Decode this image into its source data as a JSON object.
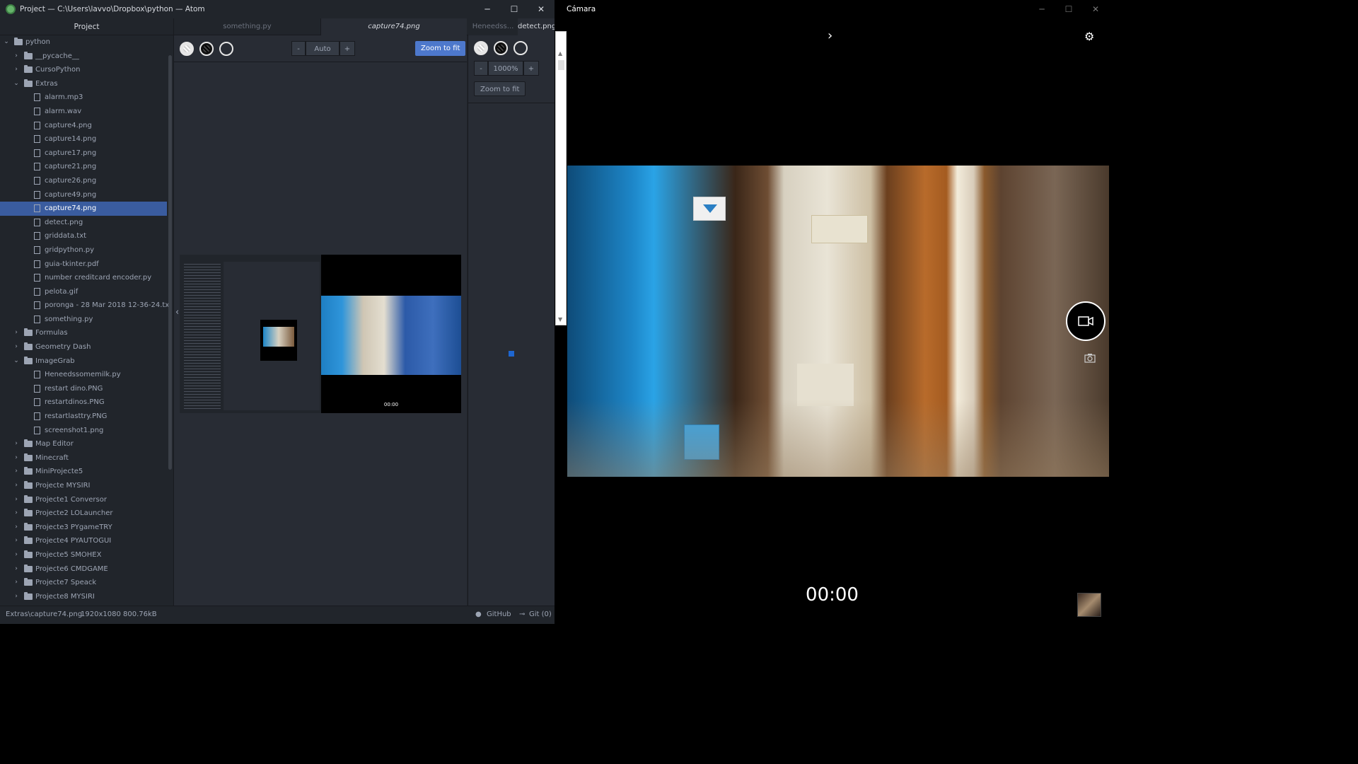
{
  "atom": {
    "title": "Project — C:\\Users\\lavvo\\Dropbox\\python — Atom",
    "minimize": "─",
    "maximize": "☐",
    "close": "✕",
    "tree_header": "Project",
    "tree": [
      {
        "label": "python",
        "type": "folder",
        "depth": 0,
        "open": true
      },
      {
        "label": "__pycache__",
        "type": "folder",
        "depth": 1,
        "open": false
      },
      {
        "label": "CursoPython",
        "type": "folder",
        "depth": 1,
        "open": false
      },
      {
        "label": "Extras",
        "type": "folder",
        "depth": 1,
        "open": true
      },
      {
        "label": "alarm.mp3",
        "type": "file",
        "depth": 2
      },
      {
        "label": "alarm.wav",
        "type": "file",
        "depth": 2
      },
      {
        "label": "capture4.png",
        "type": "file",
        "depth": 2
      },
      {
        "label": "capture14.png",
        "type": "file",
        "depth": 2
      },
      {
        "label": "capture17.png",
        "type": "file",
        "depth": 2
      },
      {
        "label": "capture21.png",
        "type": "file",
        "depth": 2
      },
      {
        "label": "capture26.png",
        "type": "file",
        "depth": 2
      },
      {
        "label": "capture49.png",
        "type": "file",
        "depth": 2
      },
      {
        "label": "capture74.png",
        "type": "file",
        "depth": 2,
        "selected": true
      },
      {
        "label": "detect.png",
        "type": "file",
        "depth": 2
      },
      {
        "label": "griddata.txt",
        "type": "file",
        "depth": 2
      },
      {
        "label": "gridpython.py",
        "type": "file",
        "depth": 2
      },
      {
        "label": "guia-tkinter.pdf",
        "type": "file",
        "depth": 2
      },
      {
        "label": "number creditcard encoder.py",
        "type": "file",
        "depth": 2
      },
      {
        "label": "pelota.gif",
        "type": "file",
        "depth": 2
      },
      {
        "label": "poronga - 28 Mar 2018 12-36-24.txt",
        "type": "file",
        "depth": 2
      },
      {
        "label": "something.py",
        "type": "file",
        "depth": 2
      },
      {
        "label": "Formulas",
        "type": "folder",
        "depth": 1,
        "open": false
      },
      {
        "label": "Geometry Dash",
        "type": "folder",
        "depth": 1,
        "open": false
      },
      {
        "label": "ImageGrab",
        "type": "folder",
        "depth": 1,
        "open": true
      },
      {
        "label": "Heneedssomemilk.py",
        "type": "file",
        "depth": 2
      },
      {
        "label": "restart dino.PNG",
        "type": "file",
        "depth": 2
      },
      {
        "label": "restartdinos.PNG",
        "type": "file",
        "depth": 2
      },
      {
        "label": "restartlasttry.PNG",
        "type": "file",
        "depth": 2
      },
      {
        "label": "screenshot1.png",
        "type": "file",
        "depth": 2
      },
      {
        "label": "Map Editor",
        "type": "folder",
        "depth": 1,
        "open": false
      },
      {
        "label": "Minecraft",
        "type": "folder",
        "depth": 1,
        "open": false
      },
      {
        "label": "MiniProjecte5",
        "type": "folder",
        "depth": 1,
        "open": false
      },
      {
        "label": "Projecte MYSIRI",
        "type": "folder",
        "depth": 1,
        "open": false
      },
      {
        "label": "Projecte1 Conversor",
        "type": "folder",
        "depth": 1,
        "open": false
      },
      {
        "label": "Projecte2 LOLauncher",
        "type": "folder",
        "depth": 1,
        "open": false
      },
      {
        "label": "Projecte3 PYgameTRY",
        "type": "folder",
        "depth": 1,
        "open": false
      },
      {
        "label": "Projecte4 PYAUTOGUI",
        "type": "folder",
        "depth": 1,
        "open": false
      },
      {
        "label": "Projecte5 SMOHEX",
        "type": "folder",
        "depth": 1,
        "open": false
      },
      {
        "label": "Projecte6 CMDGAME",
        "type": "folder",
        "depth": 1,
        "open": false
      },
      {
        "label": "Projecte7 Speack",
        "type": "folder",
        "depth": 1,
        "open": false
      },
      {
        "label": "Projecte8 MYSIRI",
        "type": "folder",
        "depth": 1,
        "open": false
      }
    ],
    "tabs": [
      {
        "label": "something.py",
        "active": false
      },
      {
        "label": "capture74.png",
        "active": true
      },
      {
        "label": "Heneedss...",
        "active": false
      },
      {
        "label": "detect.png",
        "active": true
      }
    ],
    "left_viewer": {
      "zoom_minus": "-",
      "zoom_value": "Auto",
      "zoom_plus": "+",
      "zoom_to_fit": "Zoom to fit"
    },
    "right_viewer": {
      "zoom_minus": "-",
      "zoom_value": "1000%",
      "zoom_plus": "+",
      "zoom_to_fit": "Zoom to fit"
    },
    "collapse_arrow": "‹",
    "thumb_timer": "00:00",
    "status": {
      "path": "Extras\\capture74.png",
      "info": "1920x1080 800.76kB",
      "github": "GitHub",
      "git": "Git (0)"
    }
  },
  "camera": {
    "title": "Cámara",
    "minimize": "─",
    "maximize": "☐",
    "close": "✕",
    "expand_arrow": "›",
    "timer": "00:00"
  }
}
